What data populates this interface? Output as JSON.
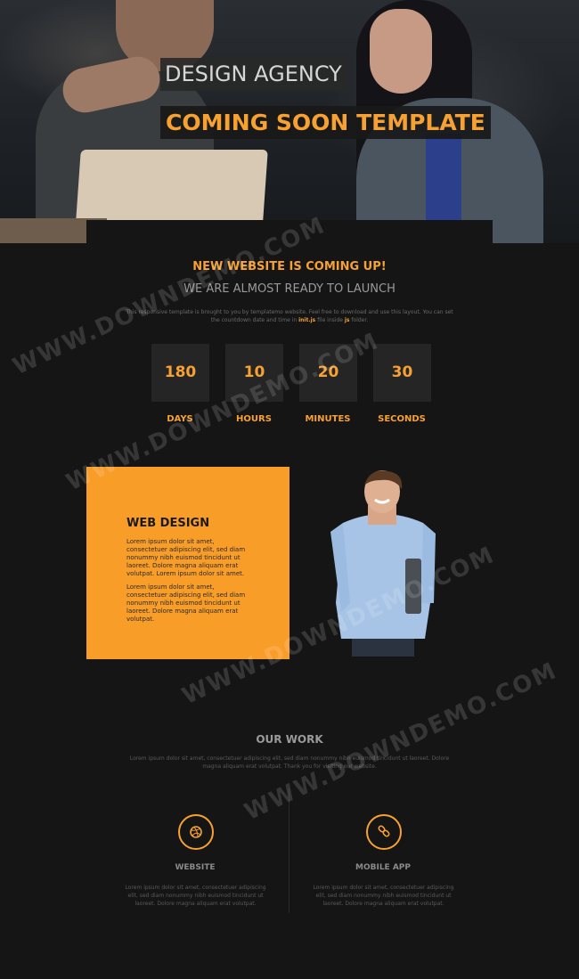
{
  "hero": {
    "title": "DESIGN AGENCY",
    "subtitle": "COMING SOON TEMPLATE"
  },
  "intro": {
    "headline": "NEW WEBSITE IS COMING UP!",
    "subheadline": "WE ARE ALMOST READY TO LAUNCH",
    "text_before": "This responsive template is brought to you by templatemo website. Feel free to download and use this layout. You can set the countdown date and time in ",
    "highlight_1": "init.js",
    "text_middle": " file inside ",
    "highlight_2": "js",
    "text_after": " folder."
  },
  "countdown": [
    {
      "value": "180",
      "label": "DAYS"
    },
    {
      "value": "10",
      "label": "HOURS"
    },
    {
      "value": "20",
      "label": "MINUTES"
    },
    {
      "value": "30",
      "label": "SECONDS"
    }
  ],
  "web_design": {
    "title": "WEB DESIGN",
    "para1": "Lorem ipsum dolor sit amet, consectetuer adipiscing elit, sed diam nonummy nibh euismod tincidunt ut laoreet. Dolore magna aliquam erat volutpat. Lorem ipsum dolor sit amet.",
    "para2": "Lorem ipsum dolor sit amet, consectetuer adipiscing elit, sed diam nonummy nibh euismod tincidunt ut laoreet. Dolore magna aliquam erat volutpat."
  },
  "our_work": {
    "title": "OUR WORK",
    "text": "Lorem ipsum dolor sit amet, consectetuer adipiscing elit, sed diam nonummy nibh euismod tincidunt ut laoreet. Dolore magna aliquam erat volutpat. Thank you for visiting our website."
  },
  "services": [
    {
      "title": "WEBSITE",
      "icon": "dribbble-icon",
      "text": "Lorem ipsum dolor sit amet, consectetuer adipiscing elit, sed diam nonummy nibh euismod tincidunt ut laoreet. Dolore magna aliquam erat volutpat."
    },
    {
      "title": "MOBILE APP",
      "icon": "link-icon",
      "text": "Lorem ipsum dolor sit amet, consectetuer adipiscing elit, sed diam nonummy nibh euismod tincidunt ut laoreet. Dolore magna aliquam erat volutpat."
    }
  ],
  "watermark": "WWW.DOWNDEMO.COM",
  "colors": {
    "accent": "#f7a132",
    "card": "#f99d29",
    "background": "#151515",
    "counter_box": "#252525"
  }
}
